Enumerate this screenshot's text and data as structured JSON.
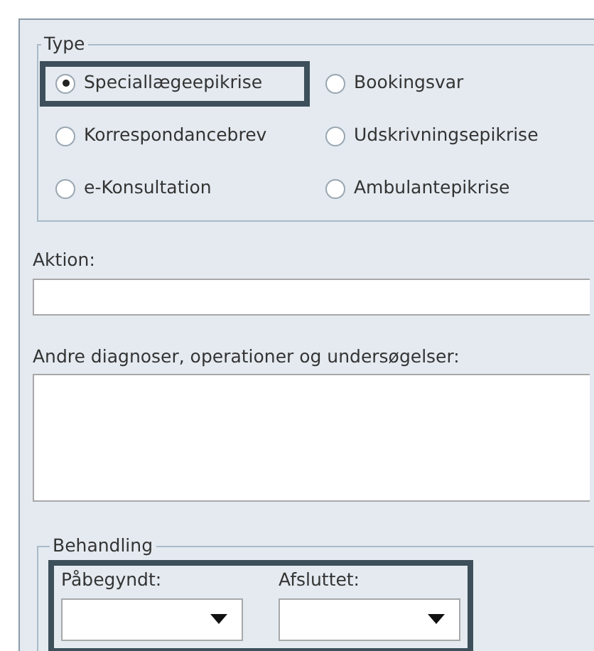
{
  "type_group": {
    "legend": "Type",
    "options": [
      {
        "label": "Speciallægeepikrise",
        "selected": true,
        "focused": true
      },
      {
        "label": "Bookingsvar",
        "selected": false,
        "focused": false
      },
      {
        "label": "Korrespondancebrev",
        "selected": false,
        "focused": false
      },
      {
        "label": "Udskrivningsepikrise",
        "selected": false,
        "focused": false
      },
      {
        "label": "e-Konsultation",
        "selected": false,
        "focused": false
      },
      {
        "label": "Ambulantepikrise",
        "selected": false,
        "focused": false
      }
    ]
  },
  "aktion": {
    "label": "Aktion:"
  },
  "andre": {
    "label": "Andre diagnoser, operationer og undersøgelser:"
  },
  "behandling": {
    "legend": "Behandling",
    "focused": true,
    "fields": [
      {
        "label": "Påbegyndt:"
      },
      {
        "label": "Afsluttet:"
      }
    ]
  }
}
